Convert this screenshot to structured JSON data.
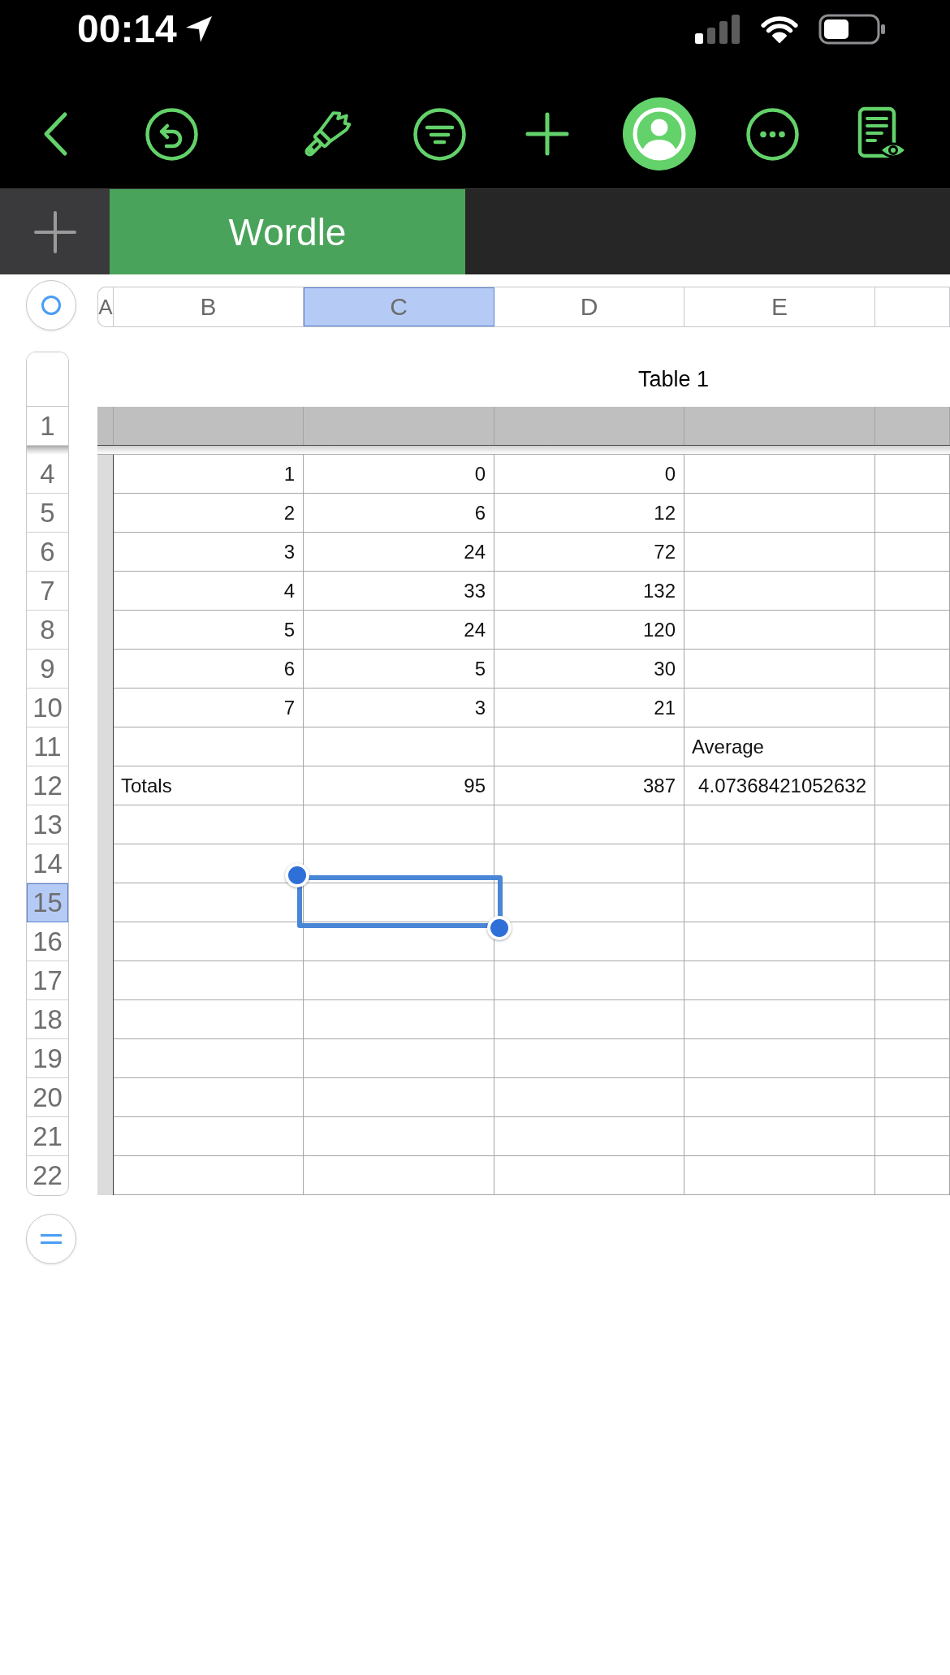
{
  "status_bar": {
    "time": "00:14"
  },
  "toolbar": [
    {
      "kind": "back",
      "on": false
    },
    {
      "kind": "undo",
      "on": false
    },
    {
      "kind": "format",
      "on": false
    },
    {
      "kind": "filter",
      "on": false
    },
    {
      "kind": "insert",
      "on": false
    },
    {
      "kind": "collaborate",
      "on": true
    },
    {
      "kind": "more",
      "on": false
    },
    {
      "kind": "reader",
      "on": false
    }
  ],
  "sheet_tabs": [
    {
      "label": "Wordle",
      "selected": true
    }
  ],
  "column_headers": [
    {
      "label": "A",
      "selected": false
    },
    {
      "label": "B",
      "selected": false
    },
    {
      "label": "C",
      "selected": true
    },
    {
      "label": "D",
      "selected": false
    },
    {
      "label": "E",
      "selected": false
    }
  ],
  "table": {
    "title": "Table 1",
    "header_row": {
      "number": "1",
      "selected": false
    },
    "rows": [
      {
        "number": "4",
        "selected": false,
        "cells": [
          {
            "text": "1",
            "kind": "number"
          },
          {
            "text": "0",
            "kind": "number"
          },
          {
            "text": "0",
            "kind": "number"
          }
        ]
      },
      {
        "number": "5",
        "selected": false,
        "cells": [
          {
            "text": "2",
            "kind": "number"
          },
          {
            "text": "6",
            "kind": "number"
          },
          {
            "text": "12",
            "kind": "number"
          }
        ]
      },
      {
        "number": "6",
        "selected": false,
        "cells": [
          {
            "text": "3",
            "kind": "number"
          },
          {
            "text": "24",
            "kind": "number"
          },
          {
            "text": "72",
            "kind": "number"
          }
        ]
      },
      {
        "number": "7",
        "selected": false,
        "cells": [
          {
            "text": "4",
            "kind": "number"
          },
          {
            "text": "33",
            "kind": "number"
          },
          {
            "text": "132",
            "kind": "number"
          }
        ]
      },
      {
        "number": "8",
        "selected": false,
        "cells": [
          {
            "text": "5",
            "kind": "number"
          },
          {
            "text": "24",
            "kind": "number"
          },
          {
            "text": "120",
            "kind": "number"
          }
        ]
      },
      {
        "number": "9",
        "selected": false,
        "cells": [
          {
            "text": "6",
            "kind": "number"
          },
          {
            "text": "5",
            "kind": "number"
          },
          {
            "text": "30",
            "kind": "number"
          }
        ]
      },
      {
        "number": "10",
        "selected": false,
        "cells": [
          {
            "text": "7",
            "kind": "number"
          },
          {
            "text": "3",
            "kind": "number"
          },
          {
            "text": "21",
            "kind": "number"
          }
        ]
      },
      {
        "number": "11",
        "selected": false,
        "cells": [
          {
            "kind": "empty"
          },
          {
            "kind": "empty"
          },
          {
            "kind": "empty"
          },
          {
            "text": "Average",
            "kind": "text"
          }
        ]
      },
      {
        "number": "12",
        "selected": false,
        "cells": [
          {
            "text": "Totals",
            "kind": "text"
          },
          {
            "text": "95",
            "kind": "number"
          },
          {
            "text": "387",
            "kind": "number"
          },
          {
            "text": "4.07368421052632",
            "kind": "number"
          }
        ]
      },
      {
        "number": "13",
        "selected": false
      },
      {
        "number": "14",
        "selected": false
      },
      {
        "number": "15",
        "selected": true
      },
      {
        "number": "16",
        "selected": false
      },
      {
        "number": "17",
        "selected": false
      },
      {
        "number": "18",
        "selected": false
      },
      {
        "number": "19",
        "selected": false
      },
      {
        "number": "20",
        "selected": false
      },
      {
        "number": "21",
        "selected": false
      },
      {
        "number": "22",
        "selected": false
      }
    ]
  }
}
